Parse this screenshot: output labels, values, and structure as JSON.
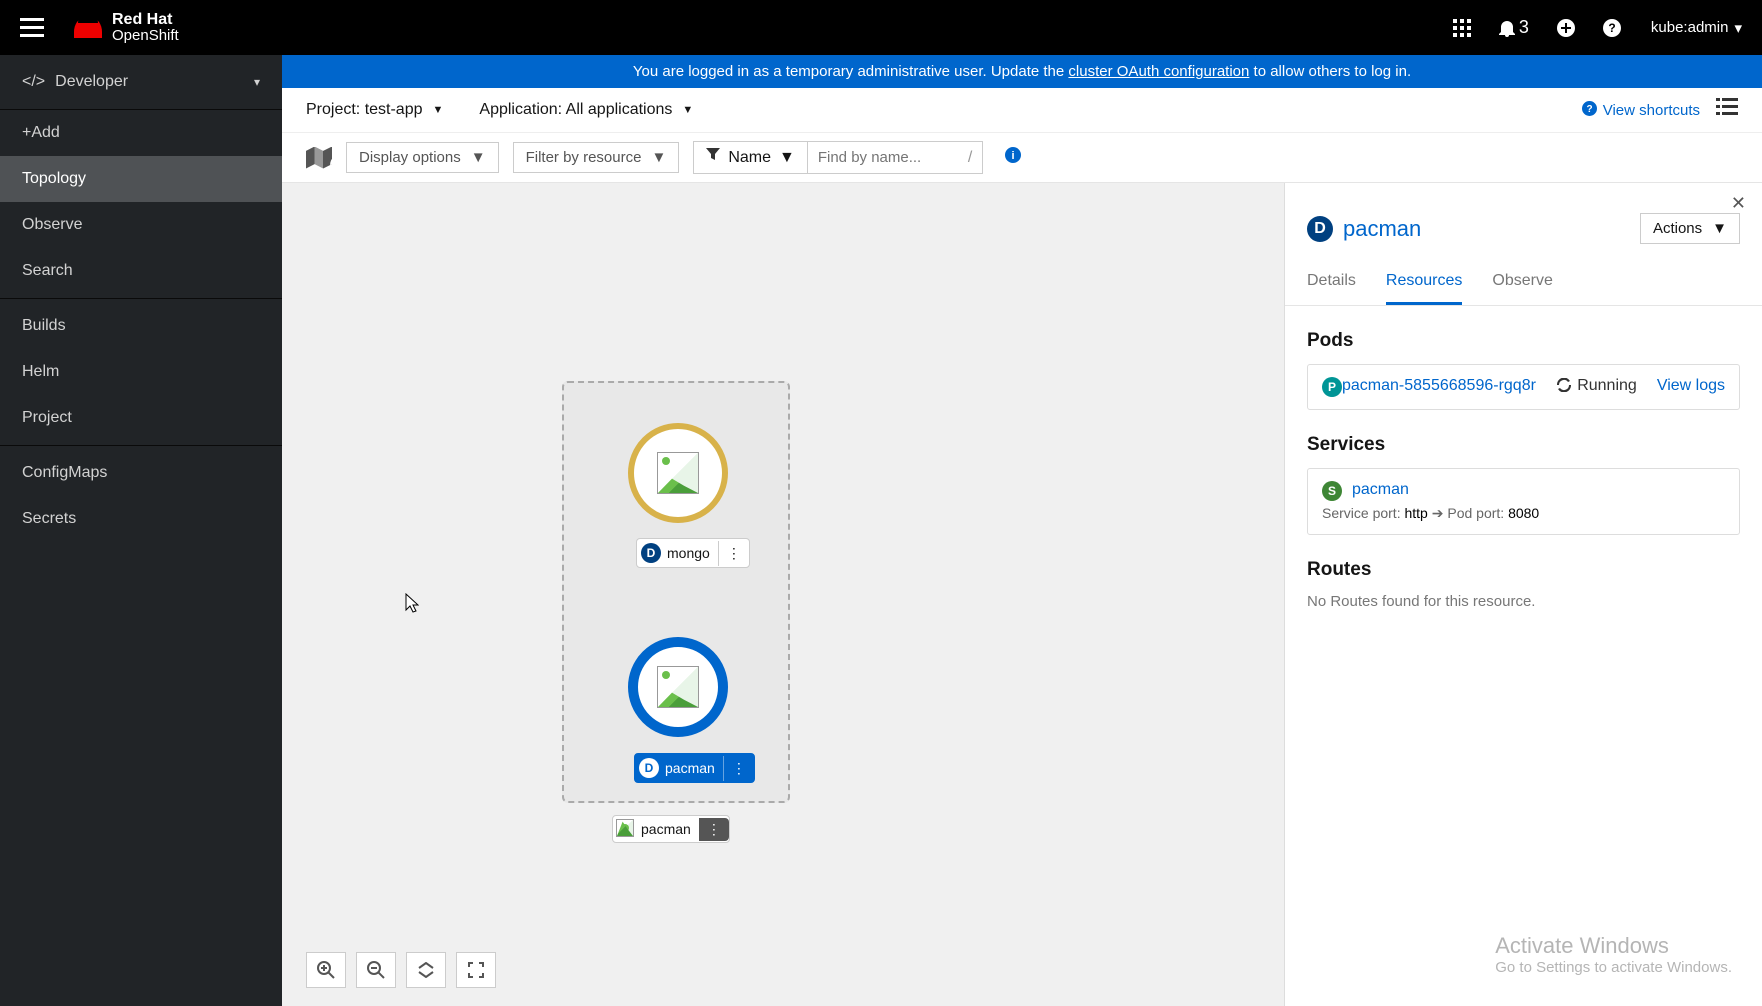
{
  "topbar": {
    "product_bold": "Red Hat",
    "product_sub": "OpenShift",
    "notif_count": "3",
    "user": "kube:admin"
  },
  "sidebar": {
    "perspective": "Developer",
    "items": [
      "+Add",
      "Topology",
      "Observe",
      "Search",
      "Builds",
      "Helm",
      "Project",
      "ConfigMaps",
      "Secrets"
    ],
    "active_index": 1
  },
  "banner": {
    "pre": "You are logged in as a temporary administrative user. Update the ",
    "link": "cluster OAuth configuration",
    "post": " to allow others to log in."
  },
  "subheader": {
    "project_label": "Project: test-app",
    "app_label": "Application: All applications",
    "shortcuts": "View shortcuts"
  },
  "toolbar": {
    "display_options": "Display options",
    "filter_by_resource": "Filter by resource",
    "name_filter_label": "Name",
    "search_placeholder": "Find by name..."
  },
  "topology": {
    "app_group_name": "pacman",
    "nodes": {
      "mongo": {
        "badge": "D",
        "label": "mongo"
      },
      "pacman": {
        "badge": "D",
        "label": "pacman"
      }
    }
  },
  "panel": {
    "badge": "D",
    "title": "pacman",
    "actions_label": "Actions",
    "tabs": {
      "details": "Details",
      "resources": "Resources",
      "observe": "Observe"
    },
    "active_tab": "resources",
    "pods": {
      "title": "Pods",
      "badge": "P",
      "name": "pacman-5855668596-rgq8r",
      "status": "Running",
      "view_logs": "View logs"
    },
    "services": {
      "title": "Services",
      "badge": "S",
      "name": "pacman",
      "service_port_label": "Service port: ",
      "service_port_value": "http",
      "pod_port_label": " Pod port: ",
      "pod_port_value": "8080"
    },
    "routes": {
      "title": "Routes",
      "empty": "No Routes found for this resource."
    }
  },
  "watermark": {
    "line1": "Activate Windows",
    "line2": "Go to Settings to activate Windows."
  }
}
